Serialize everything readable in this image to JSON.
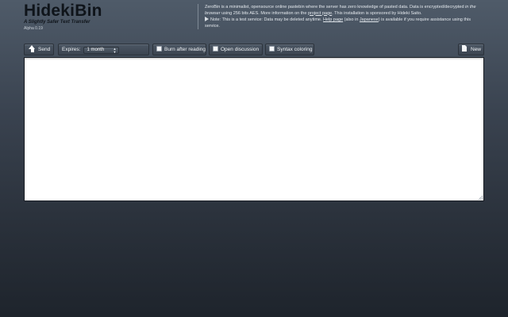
{
  "header": {
    "title": "HidekiBin",
    "tagline": "A Slightly Safer Text Transfer",
    "version": "Alpha 0.19"
  },
  "about": {
    "p1_a": "ZeroBin is a minimalist, opensource online pastebin where the server has zero knowledge of pasted data. Data is encrypted/decrypted ",
    "p1_em": "in the browser",
    "p1_b": " using 256 bits AES. More information on the ",
    "project_link": "project page",
    "p1_c": ". This installation is sponsored by Hideki Saito.",
    "note_a": "Note: This is a test service: Data may be deleted anytime. ",
    "help_link": "Help page",
    "note_b": " (also in ",
    "japanese_link": "Japanese",
    "note_c": ") is available if you require assistance using this service."
  },
  "toolbar": {
    "send_label": "Send",
    "expires_label": "Expires:",
    "expires_value": "1 month",
    "burn_label": "Burn after reading",
    "discussion_label": "Open discussion",
    "syntax_label": "Syntax coloring",
    "new_label": "New"
  },
  "icons": {
    "send": "arrow-up-icon",
    "new": "document-icon"
  },
  "editor": {
    "value": ""
  },
  "colors": {
    "background_top": "#4f5b69",
    "background_bottom": "#1e242c",
    "button": "#444e5a",
    "title": "#0f141a"
  }
}
